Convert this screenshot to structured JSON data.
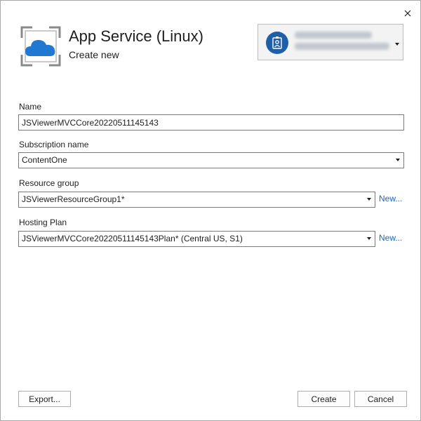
{
  "header": {
    "title": "App Service (Linux)",
    "subtitle": "Create new"
  },
  "account": {
    "icon": "contact-card-icon",
    "redacted": true
  },
  "form": {
    "name": {
      "label": "Name",
      "value": "JSViewerMVCCore20220511145143"
    },
    "subscription": {
      "label": "Subscription name",
      "value": "ContentOne"
    },
    "resource_group": {
      "label": "Resource group",
      "value": "JSViewerResourceGroup1*",
      "new_link": "New..."
    },
    "hosting_plan": {
      "label": "Hosting Plan",
      "value": "JSViewerMVCCore20220511145143Plan* (Central US, S1)",
      "new_link": "New..."
    }
  },
  "footer": {
    "export_label": "Export...",
    "create_label": "Create",
    "cancel_label": "Cancel"
  },
  "colors": {
    "accent": "#1a66c2",
    "cloud": "#1f78d1",
    "frame": "#7a7a7a"
  }
}
